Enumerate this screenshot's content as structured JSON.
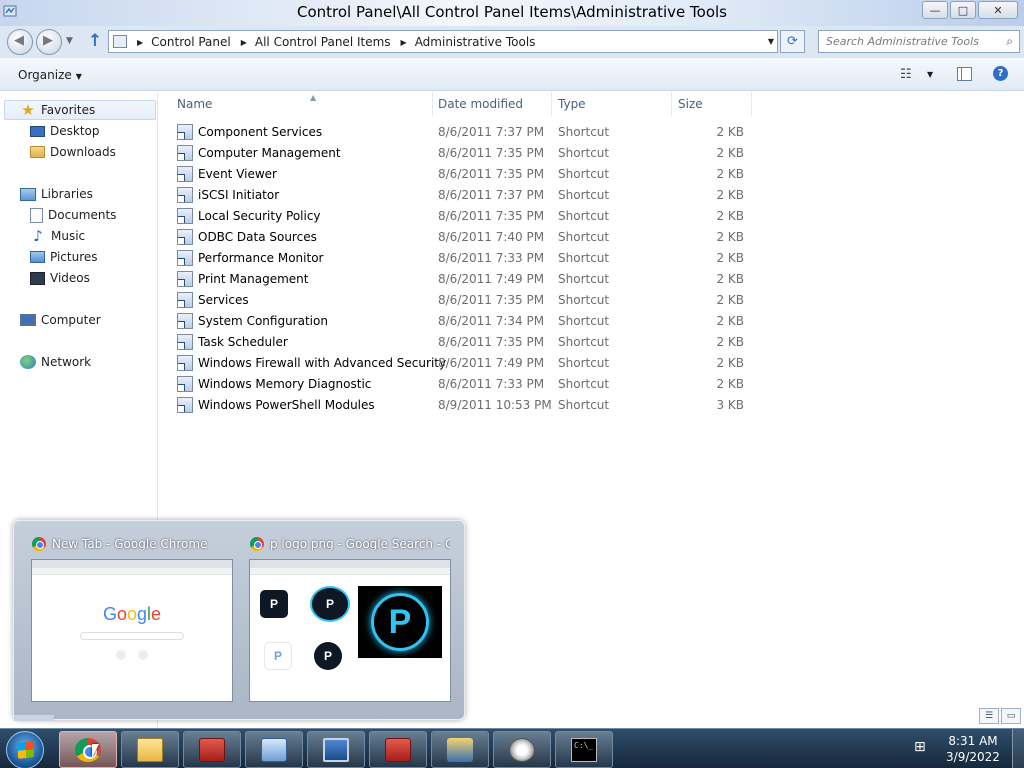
{
  "window": {
    "title": "Control Panel\\All Control Panel Items\\Administrative Tools",
    "buttons": {
      "minimize": "—",
      "maximize": "□",
      "close": "✕"
    }
  },
  "address": {
    "crumbs": [
      "Control Panel",
      "All Control Panel Items",
      "Administrative Tools"
    ]
  },
  "search": {
    "placeholder": "Search Administrative Tools"
  },
  "commandbar": {
    "organize_label": "Organize"
  },
  "navpane": {
    "favorites": {
      "label": "Favorites",
      "items": [
        "Desktop",
        "Downloads"
      ]
    },
    "libraries": {
      "label": "Libraries",
      "items": [
        "Documents",
        "Music",
        "Pictures",
        "Videos"
      ]
    },
    "computer": "Computer",
    "network": "Network"
  },
  "columns": {
    "name": "Name",
    "date": "Date modified",
    "type": "Type",
    "size": "Size"
  },
  "files": [
    {
      "name": "Component Services",
      "date": "8/6/2011 7:37 PM",
      "type": "Shortcut",
      "size": "2 KB"
    },
    {
      "name": "Computer Management",
      "date": "8/6/2011 7:35 PM",
      "type": "Shortcut",
      "size": "2 KB"
    },
    {
      "name": "Event Viewer",
      "date": "8/6/2011 7:35 PM",
      "type": "Shortcut",
      "size": "2 KB"
    },
    {
      "name": "iSCSI Initiator",
      "date": "8/6/2011 7:37 PM",
      "type": "Shortcut",
      "size": "2 KB"
    },
    {
      "name": "Local Security Policy",
      "date": "8/6/2011 7:35 PM",
      "type": "Shortcut",
      "size": "2 KB"
    },
    {
      "name": "ODBC Data Sources",
      "date": "8/6/2011 7:40 PM",
      "type": "Shortcut",
      "size": "2 KB"
    },
    {
      "name": "Performance Monitor",
      "date": "8/6/2011 7:33 PM",
      "type": "Shortcut",
      "size": "2 KB"
    },
    {
      "name": "Print Management",
      "date": "8/6/2011 7:49 PM",
      "type": "Shortcut",
      "size": "2 KB"
    },
    {
      "name": "Services",
      "date": "8/6/2011 7:35 PM",
      "type": "Shortcut",
      "size": "2 KB"
    },
    {
      "name": "System Configuration",
      "date": "8/6/2011 7:34 PM",
      "type": "Shortcut",
      "size": "2 KB"
    },
    {
      "name": "Task Scheduler",
      "date": "8/6/2011 7:35 PM",
      "type": "Shortcut",
      "size": "2 KB"
    },
    {
      "name": "Windows Firewall with Advanced Security",
      "date": "8/6/2011 7:49 PM",
      "type": "Shortcut",
      "size": "2 KB"
    },
    {
      "name": "Windows Memory Diagnostic",
      "date": "8/6/2011 7:33 PM",
      "type": "Shortcut",
      "size": "2 KB"
    },
    {
      "name": "Windows PowerShell Modules",
      "date": "8/9/2011 10:53 PM",
      "type": "Shortcut",
      "size": "3 KB"
    }
  ],
  "thumbnails": [
    {
      "title": "New Tab - Google Chrome",
      "icon": "chrome-icon"
    },
    {
      "title": "p logo png - Google Search - G...",
      "icon": "chrome-icon"
    }
  ],
  "google_logo": [
    "G",
    "o",
    "o",
    "g",
    "l",
    "e"
  ],
  "p_logo_letter": "P",
  "cmd_label": "C:\\_",
  "taskbar": {
    "apps": [
      "chrome-icon",
      "folder-icon",
      "toolbox-icon",
      "control-panel-icon",
      "computer-management-icon",
      "toolbox-icon",
      "iis-icon",
      "gauge-icon",
      "command-prompt-icon"
    ],
    "time": "8:31 AM",
    "date": "3/9/2022"
  },
  "colors": {
    "accent": "#2f72c8",
    "taskbar": "#1f3a55",
    "google_blue": "#4285f4",
    "google_red": "#ea4335",
    "google_yellow": "#fbbc05",
    "google_green": "#34a853"
  }
}
